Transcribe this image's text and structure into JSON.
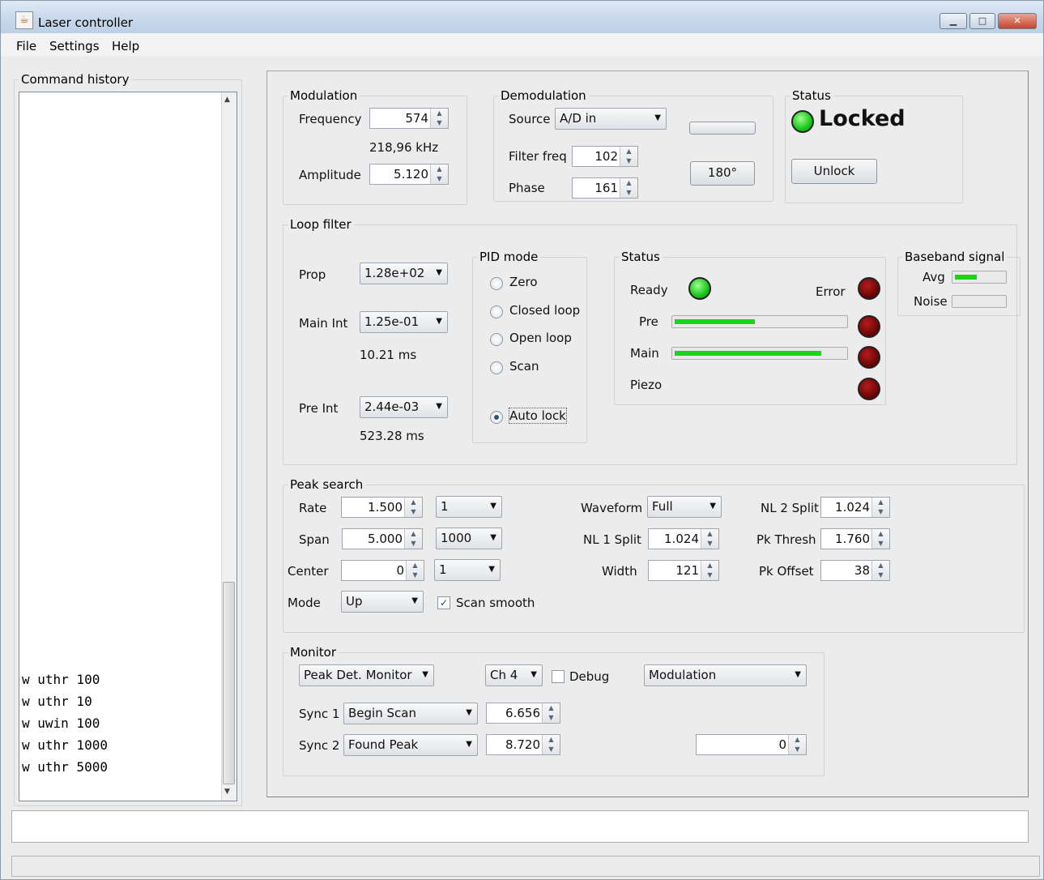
{
  "window": {
    "title": "Laser controller",
    "minimize": "▁",
    "maximize": "□",
    "close": "✕"
  },
  "menu": [
    "File",
    "Settings",
    "Help"
  ],
  "history": {
    "label": "Command history",
    "lines": [
      "w uthr 100",
      "w uthr 10",
      "w uwin 100",
      "w uthr 1000",
      "w uthr 5000"
    ]
  },
  "modulation": {
    "label": "Modulation",
    "frequency_label": "Frequency",
    "frequency_value": "574",
    "frequency_readout": "218,96 kHz",
    "amplitude_label": "Amplitude",
    "amplitude_value": "5.120"
  },
  "demodulation": {
    "label": "Demodulation",
    "source_label": "Source",
    "source_value": "A/D in",
    "filter_label": "Filter freq",
    "filter_value": "102",
    "phase_label": "Phase",
    "phase_value": "161",
    "phase_button": "180°"
  },
  "status": {
    "label": "Status",
    "state": "Locked",
    "unlock_button": "Unlock"
  },
  "loop_filter": {
    "label": "Loop filter",
    "prop_label": "Prop",
    "prop_value": "1.28e+02",
    "main_int_label": "Main Int",
    "main_int_value": "1.25e-01",
    "main_int_time": "10.21 ms",
    "pre_int_label": "Pre Int",
    "pre_int_value": "2.44e-03",
    "pre_int_time": "523.28 ms"
  },
  "pid_mode": {
    "label": "PID mode",
    "options": [
      "Zero",
      "Closed loop",
      "Open loop",
      "Scan"
    ],
    "auto_lock": "Auto lock"
  },
  "loop_status": {
    "label": "Status",
    "ready": "Ready",
    "error": "Error",
    "pre": "Pre",
    "main": "Main",
    "piezo": "Piezo",
    "pre_level": 0.47,
    "main_level": 0.86
  },
  "baseband": {
    "label": "Baseband signal",
    "avg": "Avg",
    "noise": "Noise",
    "avg_level": 0.45,
    "noise_level": 0.0
  },
  "peak_search": {
    "label": "Peak search",
    "rate_label": "Rate",
    "rate_value": "1.500",
    "rate_select": "1",
    "span_label": "Span",
    "span_value": "5.000",
    "span_select": "1000",
    "center_label": "Center",
    "center_value": "0",
    "center_select": "1",
    "mode_label": "Mode",
    "mode_value": "Up",
    "scan_smooth": "Scan smooth",
    "waveform_label": "Waveform",
    "waveform_value": "Full",
    "nl1_label": "NL 1 Split",
    "nl1_value": "1.024",
    "width_label": "Width",
    "width_value": "121",
    "nl2_label": "NL 2 Split",
    "nl2_value": "1.024",
    "pkthresh_label": "Pk Thresh",
    "pkthresh_value": "1.760",
    "pkoffset_label": "Pk Offset",
    "pkoffset_value": "38"
  },
  "monitor": {
    "label": "Monitor",
    "source_value": "Peak Det. Monitor",
    "channel_value": "Ch 4",
    "debug_label": "Debug",
    "mode_value": "Modulation",
    "sync1_label": "Sync 1",
    "sync1_value": "Begin Scan",
    "sync1_num": "6.656",
    "sync2_label": "Sync 2",
    "sync2_value": "Found Peak",
    "sync2_num": "8.720",
    "extra_value": "0"
  },
  "icons": {
    "app": "coffee-cup-icon",
    "spin": "spinner-arrows-icon",
    "dropdown": "chevron-down-icon"
  },
  "colors": {
    "led_green": "#18c619",
    "led_red": "#6a0505",
    "level_bar": "#19d419"
  }
}
